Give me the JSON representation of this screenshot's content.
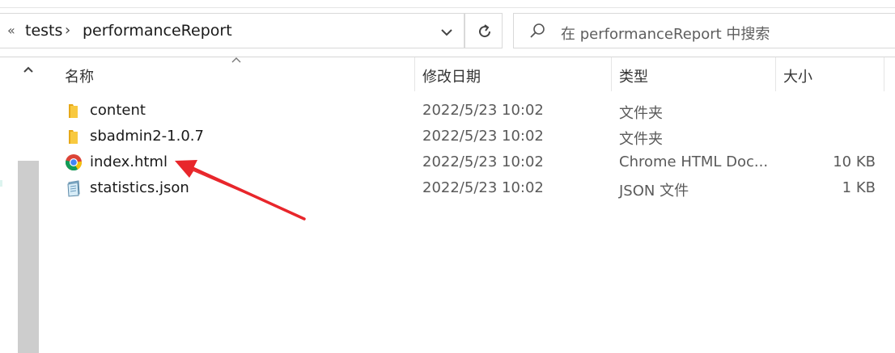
{
  "address_bar": {
    "overflow": "«",
    "crumbs": [
      "tests",
      "performanceReport"
    ]
  },
  "search": {
    "placeholder": "在 performanceReport 中搜索"
  },
  "columns": {
    "name": "名称",
    "modified": "修改日期",
    "type": "类型",
    "size": "大小"
  },
  "files": [
    {
      "name": "content",
      "modified": "2022/5/23 10:02",
      "type": "文件夹",
      "size": "",
      "icon": "folder-icon"
    },
    {
      "name": "sbadmin2-1.0.7",
      "modified": "2022/5/23 10:02",
      "type": "文件夹",
      "size": "",
      "icon": "folder-icon"
    },
    {
      "name": "index.html",
      "modified": "2022/5/23 10:02",
      "type": "Chrome HTML Doc...",
      "size": "10 KB",
      "icon": "chrome-icon"
    },
    {
      "name": "statistics.json",
      "modified": "2022/5/23 10:02",
      "type": "JSON 文件",
      "size": "1 KB",
      "icon": "json-file-icon"
    }
  ],
  "colors": {
    "annotation_arrow": "#e8262b",
    "folder": "#f8c940",
    "scroll_thumb": "#cdcdcd"
  }
}
